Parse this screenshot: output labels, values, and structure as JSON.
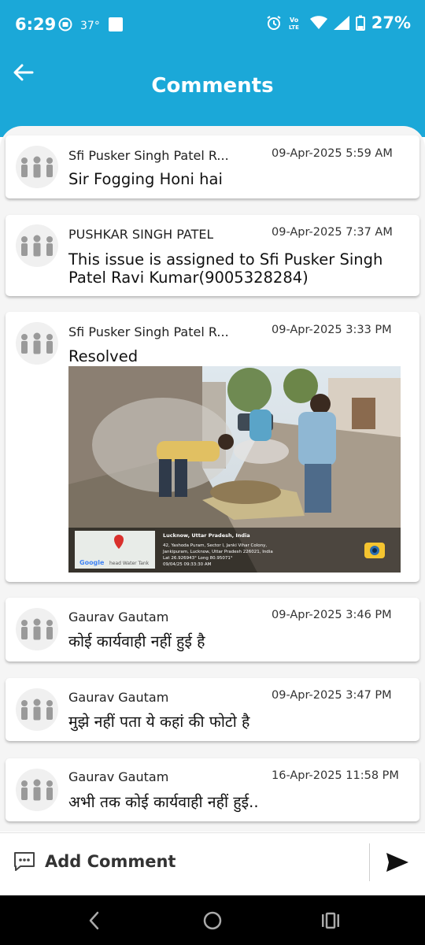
{
  "status_bar": {
    "time": "6:29",
    "temperature": "37°",
    "battery": "27%",
    "network": "Vo LTE",
    "icons": [
      "camera-app-icon",
      "notification-square-icon",
      "alarm-icon",
      "volte-icon",
      "wifi-icon",
      "signal-icon",
      "battery-icon"
    ]
  },
  "header": {
    "title": "Comments",
    "back_icon": "arrow-left-icon"
  },
  "comments": [
    {
      "author": "Sfi Pusker Singh Patel R...",
      "date": "09-Apr-2025 5:59 AM",
      "text": "Sir Fogging Honi hai"
    },
    {
      "author": "PUSHKAR SINGH PATEL",
      "date": "09-Apr-2025 7:37 AM",
      "text": "This issue is assigned to Sfi Pusker Singh Patel Ravi Kumar(9005328284)"
    },
    {
      "author": "Sfi Pusker Singh Patel R...",
      "date": "09-Apr-2025 3:33 PM",
      "text": "Resolved",
      "photo": {
        "location_title": "Lucknow, Uttar Pradesh, India",
        "address_1": "42, Yashoda Puram, Sector I, Janki Vihar Colony,",
        "address_2": "Jankipuram, Lucknow, Uttar Pradesh 226021, India",
        "coords": "Lat 26.926943° Long 80.95071°",
        "timestamp": "09/04/25 09:33:30 AM",
        "map_label": "Google",
        "map_label_2": "head Water Tank"
      }
    },
    {
      "author": "Gaurav Gautam",
      "date": "09-Apr-2025 3:46 PM",
      "text": "कोई कार्यवाही नहीं हुई है"
    },
    {
      "author": "Gaurav Gautam",
      "date": "09-Apr-2025 3:47 PM",
      "text": "मुझे नहीं पता ये कहां की फोटो है"
    },
    {
      "author": "Gaurav Gautam",
      "date": "16-Apr-2025 11:58 PM",
      "text": "अभी तक कोई कार्यवाही नहीं हुई.."
    }
  ],
  "comment_input": {
    "placeholder": "Add Comment",
    "icon": "comment-bubble-icon",
    "send_icon": "send-icon"
  },
  "nav": {
    "icons": [
      "back-nav-icon",
      "home-nav-icon",
      "recents-nav-icon"
    ]
  },
  "colors": {
    "primary": "#1ba8d8",
    "background": "#f5f5f5",
    "card": "#ffffff"
  }
}
